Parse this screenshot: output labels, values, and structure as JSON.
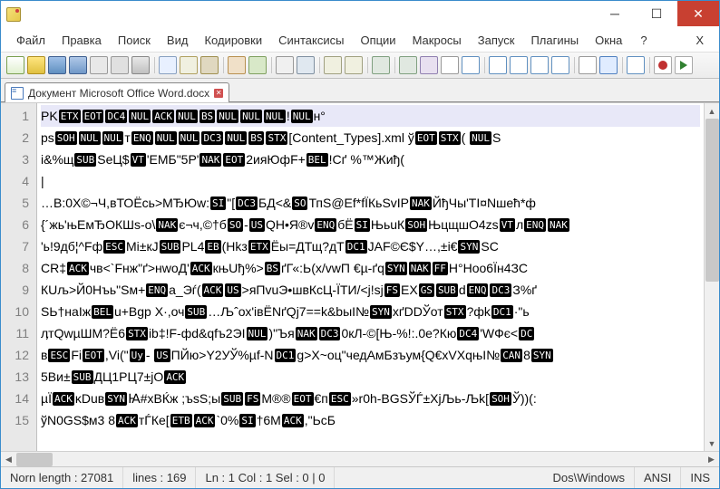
{
  "titlebar": {
    "title": ""
  },
  "menu": {
    "file": "Файл",
    "edit": "Правка",
    "search": "Поиск",
    "view": "Вид",
    "encoding": "Кодировки",
    "syntax": "Синтаксисы",
    "options": "Опции",
    "macros": "Макросы",
    "run": "Запуск",
    "plugins": "Плагины",
    "windows": "Окна",
    "help": "?",
    "close_x": "X"
  },
  "toolbar_icons": [
    "new",
    "open",
    "save",
    "saveall",
    "close",
    "closeall",
    "print",
    "sep",
    "cut",
    "copy",
    "paste",
    "sep",
    "undo",
    "redo",
    "sep",
    "find",
    "replace",
    "sep",
    "zoomin",
    "zoomout",
    "sep",
    "sync",
    "sep",
    "wrap",
    "chars",
    "indent",
    "fold",
    "sep",
    "doc1",
    "doc2",
    "doc3",
    "doc4",
    "sep",
    "mode",
    "active",
    "sep",
    "fold2",
    "sep",
    "rec",
    "play"
  ],
  "tab": {
    "name": "Документ Microsoft Office Word.docx"
  },
  "gutter": [
    "1",
    "2",
    "3",
    "4",
    "5",
    "6",
    "7",
    "8",
    "9",
    "10",
    "11",
    "12",
    "13",
    "14",
    "15"
  ],
  "lines": [
    {
      "segments": [
        {
          "t": "PK"
        },
        {
          "c": "ETX"
        },
        {
          "c": "EOT"
        },
        {
          "c": "DC4"
        },
        {
          "c": "NUL"
        },
        {
          "c": "ACK"
        },
        {
          "c": "NUL"
        },
        {
          "c": "BS"
        },
        {
          "c": "NUL"
        },
        {
          "c": "NUL"
        },
        {
          "c": "NUL"
        },
        {
          "t": "!"
        },
        {
          "c": "NUL"
        },
        {
          "t": "н°"
        }
      ],
      "current": true
    },
    {
      "segments": [
        {
          "t": "ps"
        },
        {
          "c": "SOH"
        },
        {
          "c": "NUL"
        },
        {
          "c": "NUL"
        },
        {
          "t": "т"
        },
        {
          "c": "ENQ"
        },
        {
          "c": "NUL"
        },
        {
          "c": "NUL"
        },
        {
          "c": "DC3"
        },
        {
          "c": "NUL"
        },
        {
          "c": "BS"
        },
        {
          "c": "STX"
        },
        {
          "t": "[Content_Types].xml ў"
        },
        {
          "c": "EOT"
        },
        {
          "c": "STX"
        },
        {
          "t": "( "
        },
        {
          "c": "NUL"
        },
        {
          "t": "S"
        }
      ]
    },
    {
      "segments": [
        {
          "t": "i&%щ"
        },
        {
          "c": "SUB"
        },
        {
          "t": "SeЦ$"
        },
        {
          "c": "VT"
        },
        {
          "t": "'ЕМБ\"5Р'"
        },
        {
          "c": "NAK"
        },
        {
          "c": "EOT"
        },
        {
          "t": "2ияЮфF+"
        },
        {
          "c": "BEL"
        },
        {
          "t": "!Сґ  %™Жиђ("
        }
      ]
    },
    {
      "segments": [
        {
          "t": "|"
        }
      ]
    },
    {
      "segments": [
        {
          "t": "…В:0Х©¬Ч,вТОЁсь>МЂЮw:"
        },
        {
          "c": "SI"
        },
        {
          "t": "\"["
        },
        {
          "c": "DC3"
        },
        {
          "t": "БД<&"
        },
        {
          "c": "SO"
        },
        {
          "t": "ТпS@Еf*fЇКьSvIР"
        },
        {
          "c": "NAK"
        },
        {
          "t": "ЙђЧы'ТІ¤Nшећ*ф"
        }
      ]
    },
    {
      "segments": [
        {
          "t": "{´жь'њЕмЂОКШs-о\\"
        },
        {
          "c": "NAK"
        },
        {
          "t": "є¬ч,©†б"
        },
        {
          "c": "SO"
        },
        {
          "t": "-"
        },
        {
          "c": "US"
        },
        {
          "t": "QН•Я®v"
        },
        {
          "c": "ENQ"
        },
        {
          "t": "бЁ"
        },
        {
          "c": "SI"
        },
        {
          "t": "ЊьuК"
        },
        {
          "c": "SOH"
        },
        {
          "t": "ЊцщшО4zs"
        },
        {
          "c": "VT"
        },
        {
          "t": "л"
        },
        {
          "c": "ENQ"
        },
        {
          "c": "NAK"
        }
      ]
    },
    {
      "segments": [
        {
          "t": "'ь!9дб¦^Fф"
        },
        {
          "c": "ESC"
        },
        {
          "t": "Мi±кJ"
        },
        {
          "c": "SUB"
        },
        {
          "t": "РL4"
        },
        {
          "c": "EB"
        },
        {
          "t": "(Нkз"
        },
        {
          "c": "ETX"
        },
        {
          "t": "Ёы=ДТщ?дТ"
        },
        {
          "c": "DC1"
        },
        {
          "t": "JАF©Є$Y…,±i€"
        },
        {
          "c": "SYN"
        },
        {
          "t": "SC"
        }
      ]
    },
    {
      "segments": [
        {
          "t": "СR‡"
        },
        {
          "c": "ACK"
        },
        {
          "t": "чв<`Fнж\"ґ>нwоД'"
        },
        {
          "c": "ACK"
        },
        {
          "t": "књUђ%>"
        },
        {
          "c": "BS"
        },
        {
          "t": "ґГ«:Ь(х/vwП €µ-ґq"
        },
        {
          "c": "SYN"
        },
        {
          "c": "NAK"
        },
        {
          "c": "FF"
        },
        {
          "t": "Н°Ноо6Їн4ЗC"
        }
      ]
    },
    {
      "segments": [
        {
          "t": "КUљ>Й0Нъь\"Sм+"
        },
        {
          "c": "ENQ"
        },
        {
          "t": "а_Эѓ("
        },
        {
          "c": "ACK"
        },
        {
          "c": "US"
        },
        {
          "t": ">яПvuЭ•швКсЦ-ЇТИ/<j!sj"
        },
        {
          "c": "FS"
        },
        {
          "t": "EX"
        },
        {
          "c": "GS"
        },
        {
          "c": "SUB"
        },
        {
          "t": "d"
        },
        {
          "c": "ENQ"
        },
        {
          "c": "DC3"
        },
        {
          "t": "З%ґ"
        }
      ]
    },
    {
      "segments": [
        {
          "t": "ЅЬ†наІж"
        },
        {
          "c": "BEL"
        },
        {
          "t": "u+Вgр Х·,оч"
        },
        {
          "c": "SUB"
        },
        {
          "t": "…Љˆох'iвЁNґQj7==k&bыI№"
        },
        {
          "c": "SYN"
        },
        {
          "t": "хґDDЎот"
        },
        {
          "c": "STX"
        },
        {
          "t": "?фk"
        },
        {
          "c": "DC1"
        },
        {
          "t": "·\"ь"
        }
      ]
    },
    {
      "segments": [
        {
          "t": "ӆтQwµШМ?Ё6"
        },
        {
          "c": "STX"
        },
        {
          "t": "ib‡!F-фd&qfъ2ЭІ"
        },
        {
          "c": "NUL"
        },
        {
          "t": ")\"Ъя"
        },
        {
          "c": "NAK"
        },
        {
          "c": "DC3"
        },
        {
          "t": "0кЛ-©[Њ-%!:.0е?Кю"
        },
        {
          "c": "DC4"
        },
        {
          "t": "'WФє<"
        },
        {
          "c": "DC"
        }
      ]
    },
    {
      "segments": [
        {
          "t": "в"
        },
        {
          "c": "ESC"
        },
        {
          "t": "Fi"
        },
        {
          "c": "EOT"
        },
        {
          "t": ",Vi(\""
        },
        {
          "c": "Uy"
        },
        {
          "t": "- "
        },
        {
          "c": "US"
        },
        {
          "t": "ПЙю>Y2УЎ%µf-N"
        },
        {
          "c": "DC1"
        },
        {
          "t": "g>Х~оц\"чедАмБзъум{Q€xVXqњI№"
        },
        {
          "c": "CAN"
        },
        {
          "t": "8"
        },
        {
          "c": "SYN"
        }
      ]
    },
    {
      "segments": [
        {
          "t": "5Ви±"
        },
        {
          "c": "SUB"
        },
        {
          "t": "ДЦ1РЦ7±јO"
        },
        {
          "c": "ACK"
        }
      ]
    },
    {
      "segments": [
        {
          "t": "µЇ"
        },
        {
          "c": "ACK"
        },
        {
          "t": "ĸDuв"
        },
        {
          "c": "SYN"
        },
        {
          "t": "Ꙗ#хВЌж ;ъsS;ы"
        },
        {
          "c": "SUB"
        },
        {
          "c": "FS"
        },
        {
          "t": "М®®"
        },
        {
          "c": "EOT"
        },
        {
          "t": "€п"
        },
        {
          "c": "ESC"
        },
        {
          "t": "»r0h-BGSЎЃ±ХјЉь-Љk["
        },
        {
          "c": "SOH"
        },
        {
          "t": "Ў))(:"
        }
      ]
    },
    {
      "segments": [
        {
          "t": "ўN0GS$м3 8"
        },
        {
          "c": "ACK"
        },
        {
          "t": "тЃКе["
        },
        {
          "c": "ETB"
        },
        {
          "c": "ACK"
        },
        {
          "t": "`0%"
        },
        {
          "c": "SI"
        },
        {
          "t": "†6М"
        },
        {
          "c": "ACK"
        },
        {
          "t": ",\"ЬсБ"
        }
      ]
    }
  ],
  "status": {
    "length_label": "Norn length : 27081",
    "lines_label": "lines : 169",
    "pos": "Ln : 1   Col : 1   Sel : 0 | 0",
    "eol": "Dos\\Windows",
    "encoding": "ANSI",
    "mode": "INS"
  }
}
